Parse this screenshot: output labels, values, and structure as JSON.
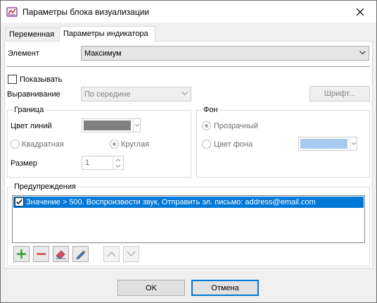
{
  "window": {
    "title": "Параметры блока визуализации",
    "title_icon": "chart-app-icon",
    "close_icon": "close-icon"
  },
  "tabs": [
    {
      "label": "Переменная",
      "active": false
    },
    {
      "label": "Параметры индикатора",
      "active": true
    }
  ],
  "element": {
    "label": "Элемент",
    "value": "Максимум"
  },
  "show": {
    "label": "Показывать",
    "checked": false
  },
  "alignment": {
    "label": "Выравнивание",
    "value": "По середине",
    "font_button": "Шрифт..."
  },
  "border": {
    "title": "Граница",
    "line_color_label": "Цвет линий",
    "line_color": "#808080",
    "square_label": "Квадратная",
    "round_label": "Круглая",
    "selected": "round",
    "size_label": "Размер",
    "size_value": "1"
  },
  "background": {
    "title": "Фон",
    "transparent_label": "Прозрачный",
    "color_label": "Цвет фона",
    "selected": "transparent",
    "color": "#a6caf0"
  },
  "warnings": {
    "title": "Предупреждения",
    "items": [
      {
        "text": "Значение > 500. Воспроизвести звук, Отправить эл. письмо: address@email.com",
        "checked": true,
        "selected": true
      }
    ]
  },
  "toolbar": {
    "add_icon": "plus-icon",
    "remove_icon": "minus-icon",
    "clear_icon": "eraser-icon",
    "edit_icon": "pencil-icon",
    "up_icon": "chevron-up-icon",
    "down_icon": "chevron-down-icon"
  },
  "footer": {
    "ok": "OK",
    "cancel": "Отмена"
  },
  "colors": {
    "selection": "#0078d7",
    "accent_green": "#2e9e2e",
    "accent_red": "#d23b3b"
  }
}
